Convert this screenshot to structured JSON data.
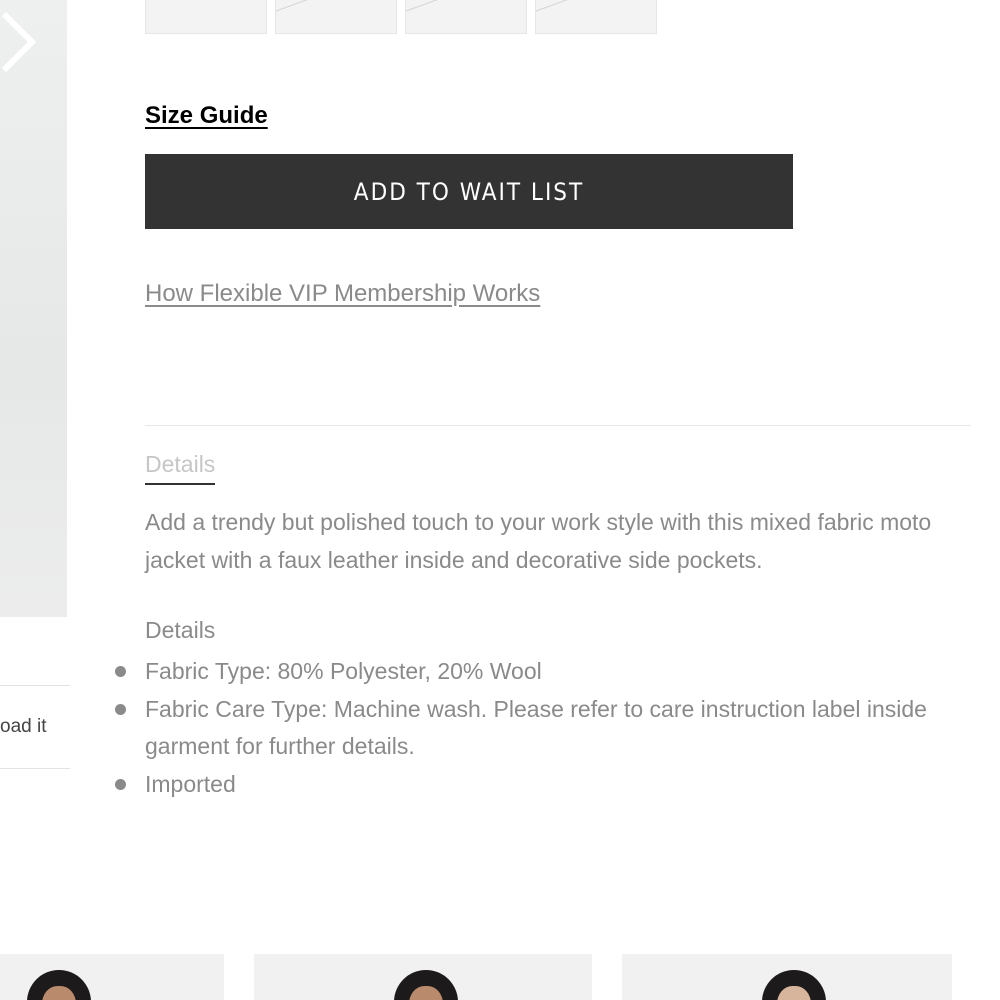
{
  "navigation": {
    "next_image_icon": "chevron-right-icon"
  },
  "left_snippet": "oad it",
  "size_guide": {
    "label": "Size Guide"
  },
  "wait_list_button": {
    "label": "ADD TO WAIT LIST"
  },
  "vip_link": {
    "label": "How Flexible VIP Membership Works"
  },
  "details_tab": {
    "label": "Details"
  },
  "description": "Add a trendy but polished touch to your work style with this mixed fabric moto jacket with a faux leather inside and decorative side pockets.",
  "details": {
    "heading": "Details",
    "items": [
      "Fabric Type: 80% Polyester, 20% Wool",
      "Fabric Care Type: Machine wash. Please refer to care instruction label inside garment for further details.",
      "Imported"
    ]
  },
  "colors": {
    "button_bg": "#333333",
    "button_text": "#ffffff",
    "body_text": "#8a8a8a",
    "tab_text": "#c6c6c6"
  }
}
